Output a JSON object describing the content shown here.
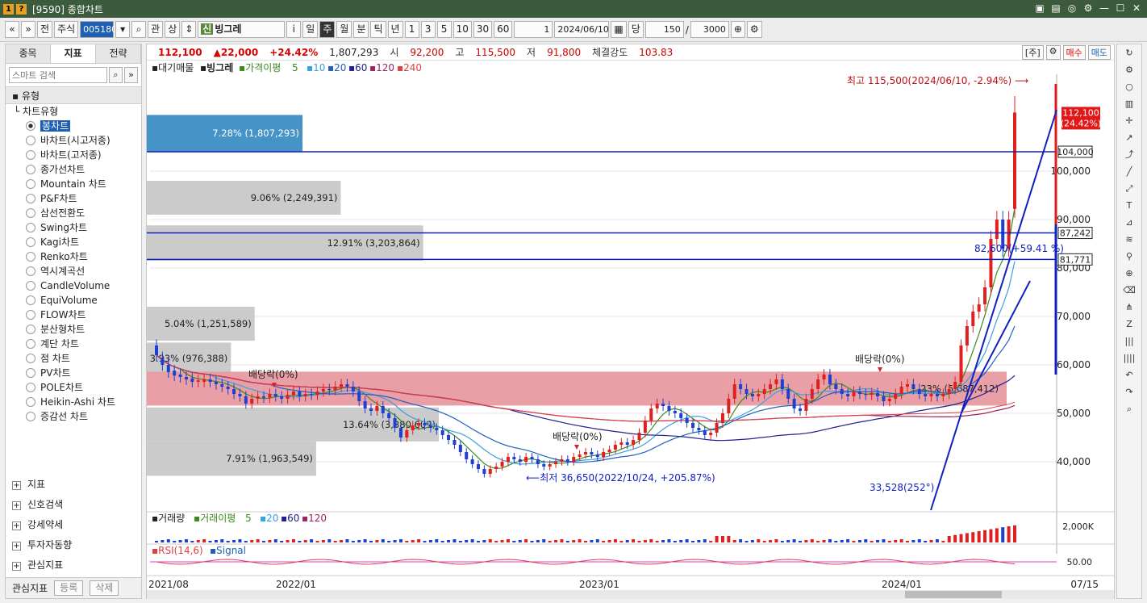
{
  "window": {
    "title": "[9590] 종합차트",
    "icon_labels": [
      "1",
      "?"
    ],
    "buttons": [
      "▣",
      "▤",
      "◎",
      "⚙",
      "—",
      "☐",
      "✕"
    ]
  },
  "toolbar": {
    "nav_prev": "«",
    "nav_down": "»",
    "market": "전",
    "stock_type": "주식",
    "code": "005180",
    "search_label": "⌕",
    "gwan": "관",
    "sang": "상",
    "sin": "신",
    "name": "빙그레",
    "info": "i",
    "periods": [
      "일",
      "주",
      "월",
      "분",
      "틱",
      "년"
    ],
    "selected_period": "주",
    "intervals": [
      "1",
      "3",
      "5",
      "10",
      "30",
      "60"
    ],
    "count": "1",
    "date": "2024/06/10",
    "dang": "당",
    "display_count": "150",
    "total_count": "3000",
    "tooltip": "주"
  },
  "left_panel": {
    "tabs": [
      "종목",
      "지표",
      "전략"
    ],
    "active_tab": "지표",
    "search_placeholder": "스마트 검색",
    "section": "유형",
    "group": "차트유형",
    "items": [
      "봉차트",
      "바차트(시고저종)",
      "바차트(고저종)",
      "종가선차트",
      "Mountain 차트",
      "P&F차트",
      "삼선전환도",
      "Swing차트",
      "Kagi차트",
      "Renko차트",
      "역시계곡선",
      "CandleVolume",
      "EquiVolume",
      "FLOW차트",
      "분산형차트",
      "계단 차트",
      "점 차트",
      "PV차트",
      "POLE차트",
      "Heikin-Ashi 차트",
      "증감선 차트"
    ],
    "selected": "봉차트",
    "bottom_groups": [
      "지표",
      "신호검색",
      "강세약세",
      "투자자동향",
      "관심지표"
    ],
    "footer_label": "관심지표",
    "footer_buttons": [
      "등록",
      "삭제"
    ]
  },
  "price_bar": {
    "price": "112,100",
    "change": "▲22,000",
    "change_pct": "+24.42%",
    "volume": "1,807,293",
    "open_label": "시",
    "open": "92,200",
    "high_label": "고",
    "high": "115,500",
    "low_label": "저",
    "low": "91,800",
    "strength_label": "체결강도",
    "strength": "103.83",
    "right_buttons": [
      "[주]",
      "⚙",
      "매수",
      "매도"
    ]
  },
  "legend": {
    "prefix": "대기매물",
    "name": "빙그레",
    "ma_label": "가격이평",
    "ma_periods": [
      "5",
      "10",
      "20",
      "60",
      "120",
      "240"
    ],
    "ma_colors": [
      "#3a8a20",
      "#3aa0e0",
      "#2060c0",
      "#202090",
      "#a02060",
      "#e04040"
    ]
  },
  "volume_legend": {
    "label": "거래량",
    "ma_label": "거래이평",
    "periods": [
      "5",
      "20",
      "60",
      "120"
    ],
    "colors": [
      "#3a8a20",
      "#3aa0e0",
      "#202090",
      "#a02060"
    ],
    "axis": "2,000K"
  },
  "rsi_legend": {
    "label": "RSI(14,6)",
    "signal": "Signal",
    "axis": "50.00"
  },
  "chart_data": {
    "type": "candlestick",
    "interval": "weekly",
    "ylim": [
      30000,
      120000
    ],
    "yticks": [
      40000,
      50000,
      60000,
      70000,
      80000,
      90000,
      100000
    ],
    "ytick_labels": [
      "40,000",
      "50,000",
      "60,000",
      "70,000",
      "80,000",
      "90,000",
      "100,000"
    ],
    "xtick_labels": [
      "2021/08",
      "2022/01",
      "2023/01",
      "2024/01",
      "07/15"
    ],
    "current_price_label": "112,100",
    "current_pct_label": "(24.42%)",
    "hlines": [
      {
        "value": 104000,
        "label": "104,000"
      },
      {
        "value": 87242,
        "label": "87,242"
      },
      {
        "value": 81771,
        "label": "81,771"
      }
    ],
    "volume_profile": [
      {
        "label": "7.28% (1,807,293)",
        "pct": 7.28,
        "from": 104000,
        "to": 111600,
        "highlight": "blue"
      },
      {
        "label": "9.06% (2,249,391)",
        "pct": 9.06,
        "from": 91000,
        "to": 98000
      },
      {
        "label": "12.91% (3,203,864)",
        "pct": 12.91,
        "from": 81500,
        "to": 88800
      },
      {
        "label": "5.04% (1,251,589)",
        "pct": 5.04,
        "from": 65000,
        "to": 72000
      },
      {
        "label": "3.93% (976,388)",
        "pct": 3.93,
        "from": 58000,
        "to": 64600
      },
      {
        "label": "23% (5,687,412)",
        "pct": 23,
        "from": 51600,
        "to": 58600,
        "highlight": "red"
      },
      {
        "label": "13.64% (3,380,609)",
        "pct": 13.64,
        "from": 44200,
        "to": 51200
      },
      {
        "label": "7.91% (1,963,549)",
        "pct": 7.91,
        "from": 37100,
        "to": 44200
      }
    ],
    "annotations": [
      {
        "text": "최고 115,500(2024/06/10, -2.94%)"
      },
      {
        "text": "최저 36,650(2022/10/24, +205.87%)"
      },
      {
        "text": "배당락(0%)"
      },
      {
        "text": "배당락(0%)"
      },
      {
        "text": "배당락(0%)"
      },
      {
        "text": "82,600(+59.41 %)"
      },
      {
        "text": "33,528(252°)"
      }
    ],
    "close": [
      62000,
      60000,
      58500,
      57800,
      57500,
      57000,
      56500,
      56800,
      57000,
      56500,
      56000,
      55500,
      55000,
      54000,
      53500,
      52000,
      53000,
      53500,
      53200,
      54000,
      53500,
      53000,
      53800,
      54500,
      53500,
      54000,
      53800,
      54500,
      55000,
      54800,
      55500,
      56000,
      55500,
      54500,
      52500,
      51000,
      50500,
      51500,
      50000,
      49000,
      47000,
      45000,
      46500,
      47500,
      48000,
      47500,
      47000,
      46500,
      45500,
      44500,
      43500,
      42000,
      40500,
      39500,
      38500,
      37500,
      38500,
      39000,
      40000,
      41000,
      40500,
      40000,
      41000,
      40500,
      39500,
      39000,
      39500,
      40000,
      40500,
      40000,
      41000,
      41500,
      42000,
      41500,
      41000,
      42000,
      42500,
      43500,
      44000,
      43500,
      44500,
      46000,
      48500,
      51000,
      52000,
      51500,
      50500,
      50000,
      49000,
      48000,
      47000,
      46500,
      45500,
      46000,
      48000,
      50000,
      53000,
      56000,
      55000,
      54000,
      53500,
      54000,
      55000,
      56000,
      57000,
      55000,
      53000,
      51000,
      50500,
      53000,
      55000,
      57000,
      58000,
      56000,
      55000,
      54000,
      53500,
      54500,
      54000,
      53800,
      54200,
      53500,
      52500,
      53000,
      54000,
      55500,
      56000,
      55000,
      54000,
      53500,
      54000,
      53500,
      54000,
      55000,
      56500,
      64000,
      68000,
      71000,
      72500,
      76000,
      86000,
      90000,
      84000,
      90000,
      112100
    ],
    "open": [
      64000,
      61500,
      60000,
      58800,
      58000,
      57500,
      57200,
      56500,
      56500,
      57000,
      56500,
      56000,
      55500,
      55000,
      54000,
      53500,
      52000,
      53000,
      53500,
      53200,
      54000,
      53500,
      53000,
      53800,
      54500,
      53500,
      54000,
      53800,
      54500,
      55000,
      54800,
      55500,
      56000,
      55500,
      54500,
      52500,
      51000,
      50500,
      51500,
      50000,
      49000,
      47000,
      45000,
      46500,
      47500,
      48000,
      47500,
      47000,
      46500,
      45500,
      44500,
      43500,
      42000,
      40500,
      39500,
      38500,
      37500,
      38500,
      39000,
      40000,
      41000,
      40500,
      40000,
      41000,
      40500,
      39500,
      39000,
      39500,
      40000,
      40500,
      40000,
      41000,
      41500,
      42000,
      41500,
      41000,
      42000,
      42500,
      43500,
      44000,
      43500,
      44500,
      46000,
      48500,
      51000,
      52000,
      51500,
      50500,
      50000,
      49000,
      48000,
      47000,
      46500,
      45500,
      46000,
      48000,
      50000,
      53000,
      56000,
      55000,
      54000,
      53500,
      54000,
      55000,
      56000,
      57000,
      55000,
      53000,
      51000,
      50500,
      53000,
      55000,
      57000,
      58000,
      56000,
      55000,
      54000,
      53500,
      54500,
      54000,
      53800,
      54200,
      53500,
      52500,
      53000,
      54000,
      55500,
      56000,
      55000,
      54000,
      53500,
      54000,
      53500,
      54000,
      55000,
      56500,
      64000,
      68000,
      71000,
      72500,
      76000,
      86000,
      90000,
      84000,
      92200
    ]
  }
}
